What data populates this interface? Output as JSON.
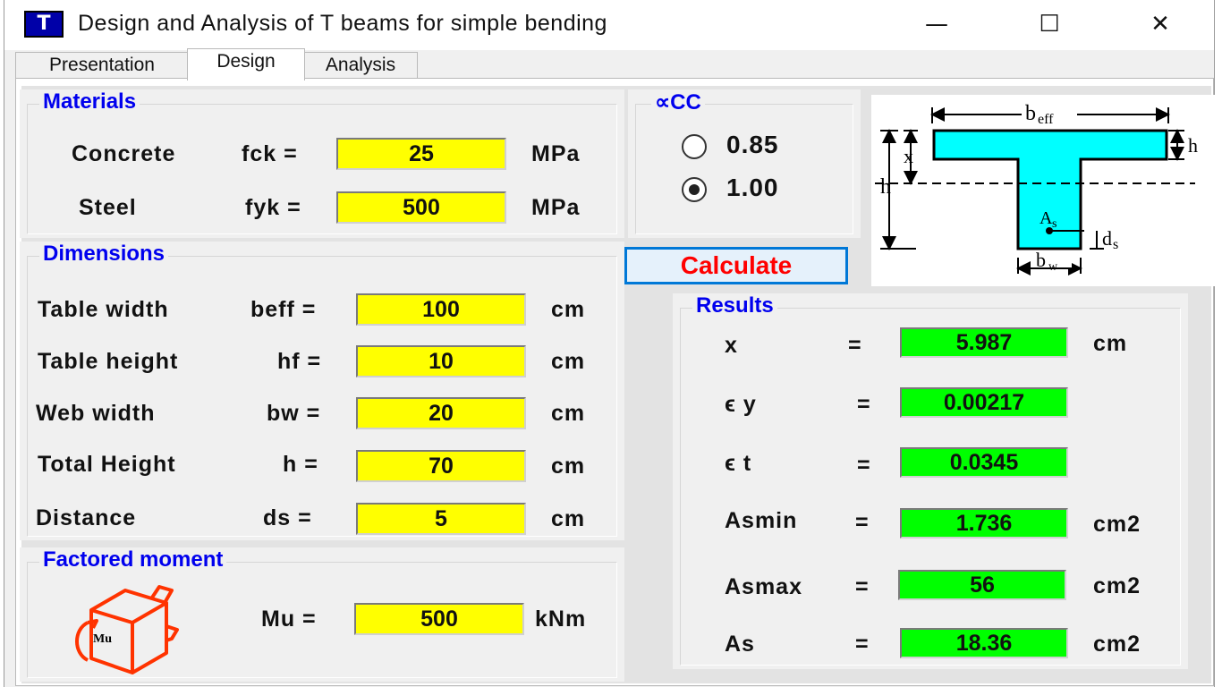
{
  "window": {
    "title": "Design and Analysis of T beams for simple bending",
    "icon_label": "T",
    "controls": {
      "minimize": "—",
      "maximize": "☐",
      "close": "✕"
    }
  },
  "tabs": [
    {
      "label": "Presentation",
      "active": false
    },
    {
      "label": "Design",
      "active": true
    },
    {
      "label": "Analysis",
      "active": false
    }
  ],
  "materials": {
    "legend": "Materials",
    "concrete": {
      "name": "Concrete",
      "symbol": "fck =",
      "value": "25",
      "unit": "MPa"
    },
    "steel": {
      "name": "Steel",
      "symbol": "fyk =",
      "value": "500",
      "unit": "MPa"
    }
  },
  "alpha_cc": {
    "legend": "∝CC",
    "options": [
      {
        "label": "0.85",
        "selected": false
      },
      {
        "label": "1.00",
        "selected": true
      }
    ]
  },
  "calculate_label": "Calculate",
  "diagram": {
    "labels": {
      "beff": "b",
      "beff_sub": "eff",
      "h_flange": "h",
      "x": "x",
      "h_total": "h",
      "As": "A",
      "As_sub": "s",
      "ds": "d",
      "ds_sub": "s",
      "bw": "b",
      "bw_sub": "w"
    }
  },
  "dimensions": {
    "legend": "Dimensions",
    "rows": [
      {
        "name": "Table width",
        "symbol": "beff =",
        "value": "100",
        "unit": "cm"
      },
      {
        "name": "Table height",
        "symbol": "hf =",
        "value": "10",
        "unit": "cm"
      },
      {
        "name": "Web width",
        "symbol": "bw =",
        "value": "20",
        "unit": "cm"
      },
      {
        "name": "Total Height",
        "symbol": "h =",
        "value": "70",
        "unit": "cm"
      },
      {
        "name": "Distance",
        "symbol": "ds =",
        "value": "5",
        "unit": "cm"
      }
    ]
  },
  "moment": {
    "legend": "Factored moment",
    "icon_label": "Mu",
    "symbol": "Mu =",
    "value": "500",
    "unit": "kNm"
  },
  "results": {
    "legend": "Results",
    "rows": [
      {
        "name": "x",
        "eq": "=",
        "value": "5.987",
        "unit": "cm"
      },
      {
        "name": "ϵ y",
        "eq": "=",
        "value": "0.00217",
        "unit": ""
      },
      {
        "name": "ϵ t",
        "eq": "=",
        "value": "0.0345",
        "unit": ""
      },
      {
        "name": "Asmin",
        "eq": "=",
        "value": "1.736",
        "unit": "cm2"
      },
      {
        "name": "Asmax",
        "eq": "=",
        "value": "56",
        "unit": "cm2"
      },
      {
        "name": "As",
        "eq": "=",
        "value": "18.36",
        "unit": "cm2"
      }
    ]
  },
  "colors": {
    "input_bg": "#ffff00",
    "output_bg": "#00ff00",
    "legend_text": "#0000ee",
    "calculate_text": "#ff0000",
    "beam_fill": "#00ffff",
    "moment_icon": "#ff3300"
  }
}
